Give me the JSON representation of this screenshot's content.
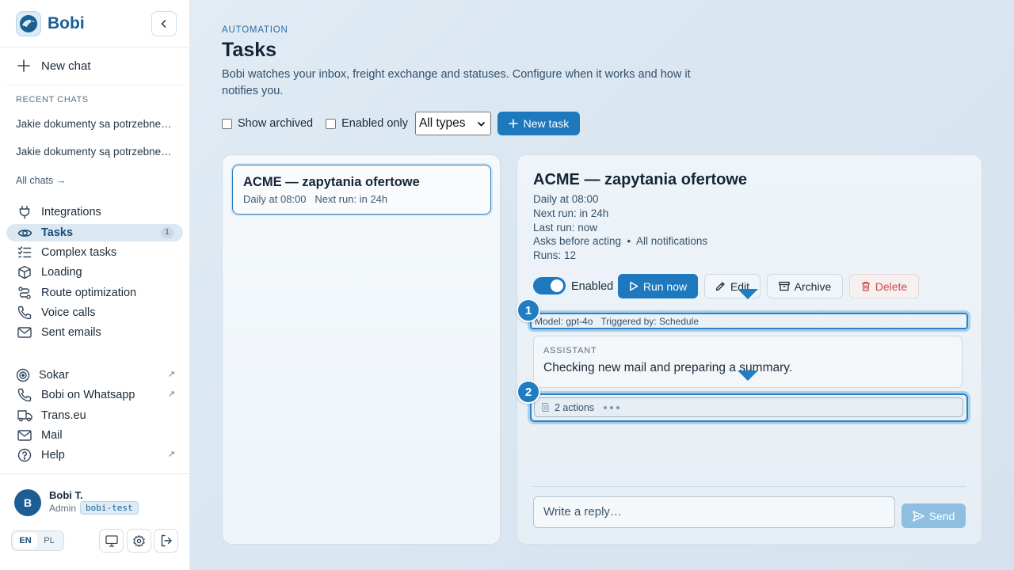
{
  "app": {
    "name": "Bobi"
  },
  "sidebar": {
    "new_chat": "New chat",
    "recent_label": "RECENT CHATS",
    "recent_chats": [
      "Jakie dokumenty sa potrzebne do...",
      "Jakie dokumenty są potrzebne do..."
    ],
    "all_chats": "All chats →",
    "nav": [
      {
        "label": "Integrations",
        "icon": "plug-icon"
      },
      {
        "label": "Tasks",
        "icon": "eye-icon",
        "badge": "1",
        "active": true
      },
      {
        "label": "Complex tasks",
        "icon": "checklist-icon"
      },
      {
        "label": "Loading",
        "icon": "box-icon"
      },
      {
        "label": "Route optimization",
        "icon": "route-icon"
      },
      {
        "label": "Voice calls",
        "icon": "phone-icon"
      },
      {
        "label": "Sent emails",
        "icon": "mail-icon"
      }
    ],
    "links": [
      {
        "label": "Sokar",
        "icon": "pin-icon",
        "external": true
      },
      {
        "label": "Bobi on Whatsapp",
        "icon": "whatsapp-icon",
        "external": true
      },
      {
        "label": "Trans.eu",
        "icon": "truck-icon",
        "external": false
      },
      {
        "label": "Mail",
        "icon": "mail-icon",
        "external": false
      },
      {
        "label": "Help",
        "icon": "help-icon",
        "external": true
      }
    ],
    "user": {
      "initial": "B",
      "name": "Bobi T.",
      "role": "Admin",
      "org": "bobi-test"
    },
    "lang": {
      "en": "EN",
      "pl": "PL",
      "selected": "EN"
    }
  },
  "header": {
    "eyebrow": "AUTOMATION",
    "title": "Tasks",
    "description": "Bobi watches your inbox, freight exchange and statuses. Configure when it works and how it notifies you."
  },
  "filters": {
    "show_archived": "Show archived",
    "enabled_only": "Enabled only",
    "type_select": "All types",
    "new_task": "New task"
  },
  "task_list": [
    {
      "title": "ACME — zapytania ofertowe",
      "schedule": "Daily at 08:00",
      "next_run": "Next run: in 24h"
    }
  ],
  "detail": {
    "title": "ACME — zapytania ofertowe",
    "schedule": "Daily at 08:00",
    "next_run": "Next run: in 24h",
    "last_run": "Last run: now",
    "mode": "Asks before acting  •  All notifications",
    "runs": "Runs: 12",
    "toggle_label": "Enabled",
    "toggle_on": true,
    "buttons": {
      "run_now": "Run now",
      "edit": "Edit",
      "archive": "Archive",
      "delete": "Delete"
    },
    "model": "Model: gpt-4o",
    "triggered_by": "Triggered by: Schedule",
    "assistant_role": "ASSISTANT",
    "assistant_message": "Checking new mail and preparing a summary.",
    "actions": "2 actions",
    "reply_placeholder": "Write a reply…",
    "send": "Send"
  },
  "markers": [
    "1",
    "2"
  ],
  "colors": {
    "accent": "#1e78bd",
    "brand": "#1a5f94",
    "danger": "#cf4a4a",
    "highlight": "#2b82c8"
  }
}
